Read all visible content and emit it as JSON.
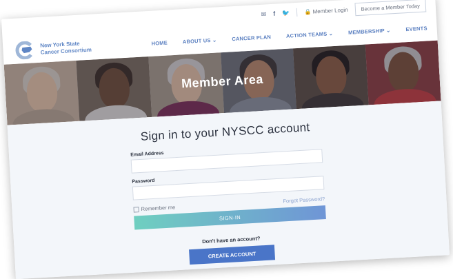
{
  "topbar": {
    "mail_icon": "envelope-icon",
    "facebook_icon": "facebook-icon",
    "twitter_icon": "twitter-icon",
    "member_login": "Member Login",
    "become_member": "Become a Member Today"
  },
  "logo": {
    "line1": "New York State",
    "line2": "Cancer Consortium"
  },
  "nav": {
    "items": [
      "HOME",
      "ABOUT US ⌄",
      "CANCER PLAN",
      "ACTION TEAMS ⌄",
      "MEMBERSHIP ⌄",
      "EVENTS"
    ]
  },
  "hero": {
    "title": "Member Area"
  },
  "signin": {
    "title": "Sign in to your NYSCC account",
    "email_label": "Email Address",
    "email_value": "",
    "password_label": "Password",
    "password_value": "",
    "remember_label": "Remember me",
    "forgot_label": "Forgot Password?",
    "button_label": "SIGN-IN"
  },
  "signup": {
    "prompt": "Don't have an account?",
    "button_label": "CREATE ACCOUNT"
  },
  "colors": {
    "brand_blue": "#4a75c8",
    "nav_text": "#5a7fc0",
    "signin_gradient_start": "#6fcfc0",
    "signin_gradient_end": "#6f95d6"
  }
}
